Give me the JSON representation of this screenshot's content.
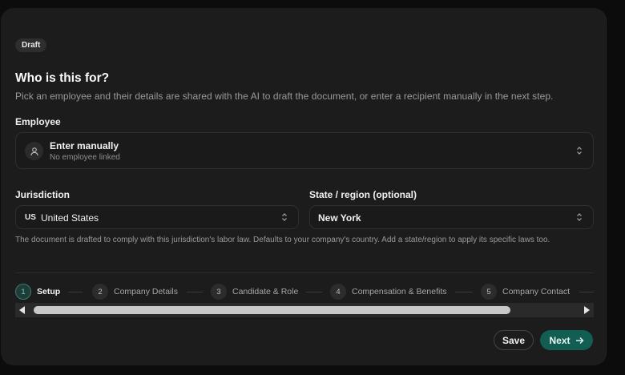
{
  "badge": "Draft",
  "header": {
    "title": "Who is this for?",
    "subtitle": "Pick an employee and their details are shared with the AI to draft the document, or enter a recipient manually in the next step."
  },
  "employee": {
    "label": "Employee",
    "value": "Enter manually",
    "sub": "No employee linked"
  },
  "jurisdiction": {
    "label": "Jurisdiction",
    "code": "US",
    "value": "United States"
  },
  "state": {
    "label": "State / region (optional)",
    "value": "New York"
  },
  "helper": "The document is drafted to comply with this jurisdiction's labor law. Defaults to your company's country. Add a state/region to apply its specific laws too.",
  "steps": [
    {
      "num": "1",
      "label": "Setup",
      "active": true
    },
    {
      "num": "2",
      "label": "Company Details",
      "active": false
    },
    {
      "num": "3",
      "label": "Candidate & Role",
      "active": false
    },
    {
      "num": "4",
      "label": "Compensation & Benefits",
      "active": false
    },
    {
      "num": "5",
      "label": "Company Contact",
      "active": false
    }
  ],
  "scrollbar": {
    "thumb_fraction": 0.88
  },
  "actions": {
    "save": "Save",
    "next": "Next"
  },
  "colors": {
    "accent": "#125e52",
    "card": "#1c1c1c",
    "background": "#0c0c0c"
  },
  "icons": {
    "avatar": "user-icon",
    "select": "chevron-up-down-icon",
    "next": "arrow-right-icon"
  }
}
